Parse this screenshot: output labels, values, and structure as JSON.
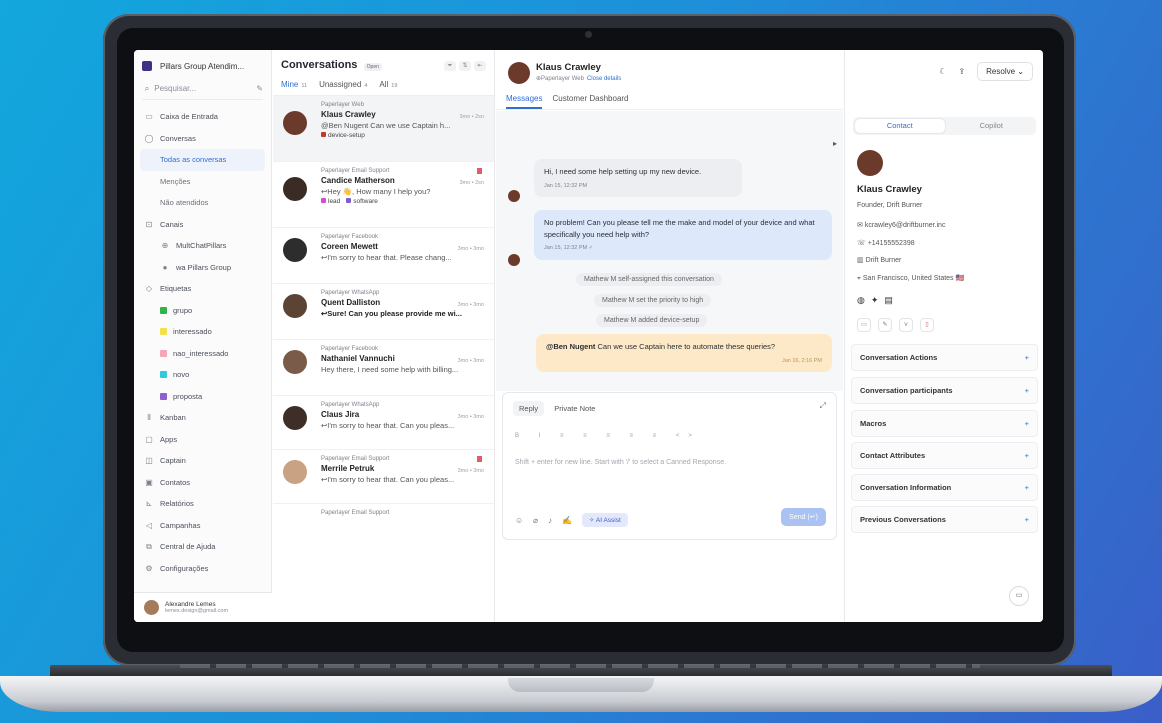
{
  "sidebar": {
    "workspace": "Pillars Group Atendim...",
    "search_placeholder": "Pesquisar...",
    "items": [
      {
        "label": "Caixa de Entrada",
        "icon": "inbox-icon"
      },
      {
        "label": "Conversas",
        "icon": "chat-icon"
      },
      {
        "label": "Todas as conversas"
      },
      {
        "label": "Menções"
      },
      {
        "label": "Não atendidos"
      },
      {
        "label": "Canais",
        "icon": "channel-icon"
      },
      {
        "label": "MultChatPillars"
      },
      {
        "label": "wa Pillars Group"
      },
      {
        "label": "Etiquetas",
        "icon": "tag-icon"
      },
      {
        "label": "grupo",
        "color": "#32b34a"
      },
      {
        "label": "interessado",
        "color": "#f4e14a"
      },
      {
        "label": "nao_interessado",
        "color": "#f3a6b4"
      },
      {
        "label": "novo",
        "color": "#30c8dc"
      },
      {
        "label": "proposta",
        "color": "#8e5fd1"
      },
      {
        "label": "Kanban",
        "icon": "kanban-icon"
      },
      {
        "label": "Apps",
        "icon": "apps-icon"
      },
      {
        "label": "Captain",
        "icon": "captain-icon"
      },
      {
        "label": "Contatos",
        "icon": "contacts-icon"
      },
      {
        "label": "Relatórios",
        "icon": "reports-icon"
      },
      {
        "label": "Campanhas",
        "icon": "campaign-icon"
      },
      {
        "label": "Central de Ajuda",
        "icon": "help-icon"
      },
      {
        "label": "Configurações",
        "icon": "settings-icon"
      }
    ],
    "user": {
      "name": "Alexandre Lemes",
      "email": "lemes.design@gmail.com"
    }
  },
  "conversations": {
    "title": "Conversations",
    "status": "Open",
    "tabs": [
      {
        "label": "Mine",
        "count": "11"
      },
      {
        "label": "Unassigned",
        "count": "4"
      },
      {
        "label": "All",
        "count": "19"
      }
    ],
    "list": [
      {
        "source": "Paperlayer Web",
        "name": "Klaus Crawley",
        "message": "@Ben Nugent Can we use Captain h...",
        "time": "3mo • 2sn",
        "labels": [
          {
            "text": "device-setup",
            "color": "#c0392b"
          }
        ],
        "avatar_color": "#6b3a2a"
      },
      {
        "source": "Paperlayer Email Support",
        "name": "Candice Matherson",
        "message": "↩Hey 👋, How many I help you?",
        "time": "3mo • 2sn",
        "labels": [
          {
            "text": "lead",
            "color": "#d64bd6"
          },
          {
            "text": "software",
            "color": "#7b5fd1"
          }
        ],
        "avatar_color": "#3a2c24"
      },
      {
        "source": "Paperlayer Facebook",
        "name": "Coreen Mewett",
        "message": "↩I'm sorry to hear that. Please chang...",
        "time": "3mo • 3mo",
        "labels": [],
        "avatar_color": "#2d2d2d"
      },
      {
        "source": "Paperlayer WhatsApp",
        "name": "Quent Dalliston",
        "message": "↩Sure! Can you please provide me wi...",
        "time": "3mo • 3mo",
        "labels": [],
        "avatar_color": "#5b4433"
      },
      {
        "source": "Paperlayer Facebook",
        "name": "Nathaniel Vannuchi",
        "message": "Hey there, I need some help with billing...",
        "time": "3mo • 3mo",
        "labels": [],
        "avatar_color": "#7a5a48"
      },
      {
        "source": "Paperlayer WhatsApp",
        "name": "Claus Jira",
        "message": "↩I'm sorry to hear that. Can you pleas...",
        "time": "3mo • 3mo",
        "labels": [],
        "avatar_color": "#3d2f28"
      },
      {
        "source": "Paperlayer Email Support",
        "name": "Merrile Petruk",
        "message": "↩I'm sorry to hear that. Can you pleas...",
        "time": "3mo • 3mo",
        "labels": [],
        "avatar_color": "#c9a183"
      },
      {
        "source": "Paperlayer Email Support",
        "name": "",
        "message": "",
        "time": "",
        "labels": [],
        "avatar_color": ""
      }
    ]
  },
  "main": {
    "contact_name": "Klaus Crawley",
    "source": "Paperlayer Web",
    "close_details": "Close details",
    "tabs": [
      "Messages",
      "Customer Dashboard"
    ],
    "messages": [
      {
        "text": "Hi, I need some help setting up my new device.",
        "time": "Jan 15, 12:32 PM"
      },
      {
        "text": "No problem! Can you please tell me the make and model of your device and what specifically you need help with?",
        "time": "Jan 15, 12:32 PM ✓"
      }
    ],
    "activities": [
      "Mathew M self-assigned this conversation",
      "Mathew M set the priority to high",
      "Mathew M added device-setup"
    ],
    "note": {
      "mention": "@Ben Nugent",
      "text": " Can we use Captain here to automate these queries?",
      "time": "Jan 16, 2:16 PM"
    },
    "composer": {
      "tabs": [
        "Reply",
        "Private Note"
      ],
      "placeholder": "Shift + enter for new line. Start with '/' to select a Canned Response.",
      "ai_label": "AI Assist",
      "send_label": "Send (↵)"
    }
  },
  "right": {
    "resolve_label": "Resolve",
    "tabs": [
      "Contact",
      "Copilot"
    ],
    "contact": {
      "name": "Klaus Crawley",
      "role": "Founder, Drift Burner",
      "email": "kcrawley6@driftburner.inc",
      "phone": "+14155552398",
      "company": "Drift Burner",
      "location": "San Francisco, United States 🇺🇸"
    },
    "sections": [
      "Conversation Actions",
      "Conversation participants",
      "Macros",
      "Contact Attributes",
      "Conversation Information",
      "Previous Conversations"
    ]
  }
}
